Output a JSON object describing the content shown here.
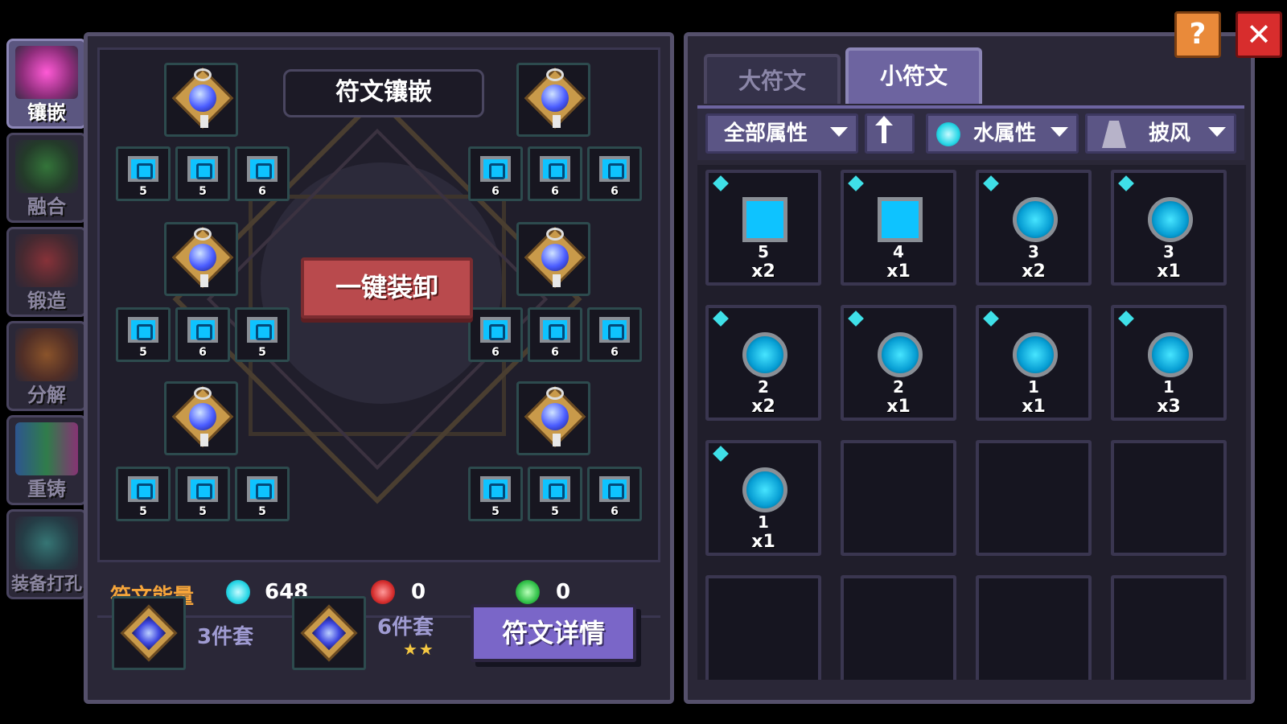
{
  "side_nav": [
    {
      "label": "镶嵌",
      "active": true,
      "color": "#e34ac4"
    },
    {
      "label": "融合",
      "active": false,
      "color": "#2a7a2a"
    },
    {
      "label": "锻造",
      "active": false,
      "color": "#9b2a2a"
    },
    {
      "label": "分解",
      "active": false,
      "color": "#9b4a1a"
    },
    {
      "label": "重铸",
      "active": false,
      "color": "#3a7a4a"
    },
    {
      "label": "装备打孔",
      "active": false,
      "color": "#2f6a6a"
    }
  ],
  "inlay": {
    "title": "符文镶嵌",
    "unequip_button": "一键装卸",
    "left_small_levels": [
      [
        "5",
        "5",
        "6"
      ],
      [
        "5",
        "6",
        "5"
      ],
      [
        "5",
        "5",
        "5"
      ]
    ],
    "right_small_levels": [
      [
        "6",
        "6",
        "6"
      ],
      [
        "6",
        "6",
        "6"
      ],
      [
        "5",
        "5",
        "6"
      ]
    ]
  },
  "energy": {
    "label": "符文能量",
    "water": "648",
    "fire": "0",
    "wind": "0"
  },
  "sets": {
    "set3": "3件套",
    "set6": "6件套",
    "stars": "★★"
  },
  "detail_button": "符文详情",
  "tabs": {
    "big": "大符文",
    "small": "小符文"
  },
  "filters": {
    "all_attr": "全部属性",
    "water_attr": "水属性",
    "slot": "披风"
  },
  "inventory": [
    {
      "level": "5",
      "qty": "x2",
      "shape": "plate"
    },
    {
      "level": "4",
      "qty": "x1",
      "shape": "plate"
    },
    {
      "level": "3",
      "qty": "x2",
      "shape": "disc"
    },
    {
      "level": "3",
      "qty": "x1",
      "shape": "disc"
    },
    {
      "level": "2",
      "qty": "x2",
      "shape": "disc"
    },
    {
      "level": "2",
      "qty": "x1",
      "shape": "disc"
    },
    {
      "level": "1",
      "qty": "x1",
      "shape": "disc"
    },
    {
      "level": "1",
      "qty": "x3",
      "shape": "disc"
    },
    {
      "level": "1",
      "qty": "x1",
      "shape": "disc"
    }
  ],
  "buttons": {
    "help": "?",
    "close": "✕"
  }
}
